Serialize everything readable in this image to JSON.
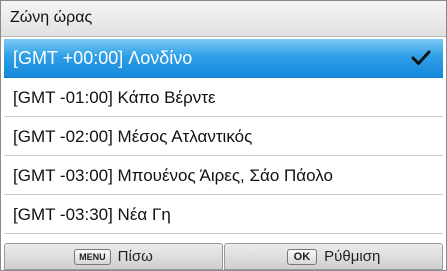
{
  "header": {
    "title": "Ζώνη ώρας"
  },
  "timezones": [
    {
      "label": "[GMT +00:00] Λονδίνο",
      "selected": true
    },
    {
      "label": "[GMT -01:00] Κάπο Βέρντε",
      "selected": false
    },
    {
      "label": "[GMT -02:00] Μέσος Ατλαντικός",
      "selected": false
    },
    {
      "label": "[GMT -03:00] Μπουένος Άιρες, Σάο Πάολο",
      "selected": false
    },
    {
      "label": "[GMT -03:30] Νέα Γη",
      "selected": false
    }
  ],
  "selected_icon": "checkmark-icon",
  "footer": {
    "back": {
      "key": "MENU",
      "label": "Πίσω"
    },
    "set": {
      "key": "OK",
      "label": "Ρύθμιση"
    }
  },
  "colors": {
    "selection": "#2f9fe6",
    "selection_text": "#ffffff"
  }
}
